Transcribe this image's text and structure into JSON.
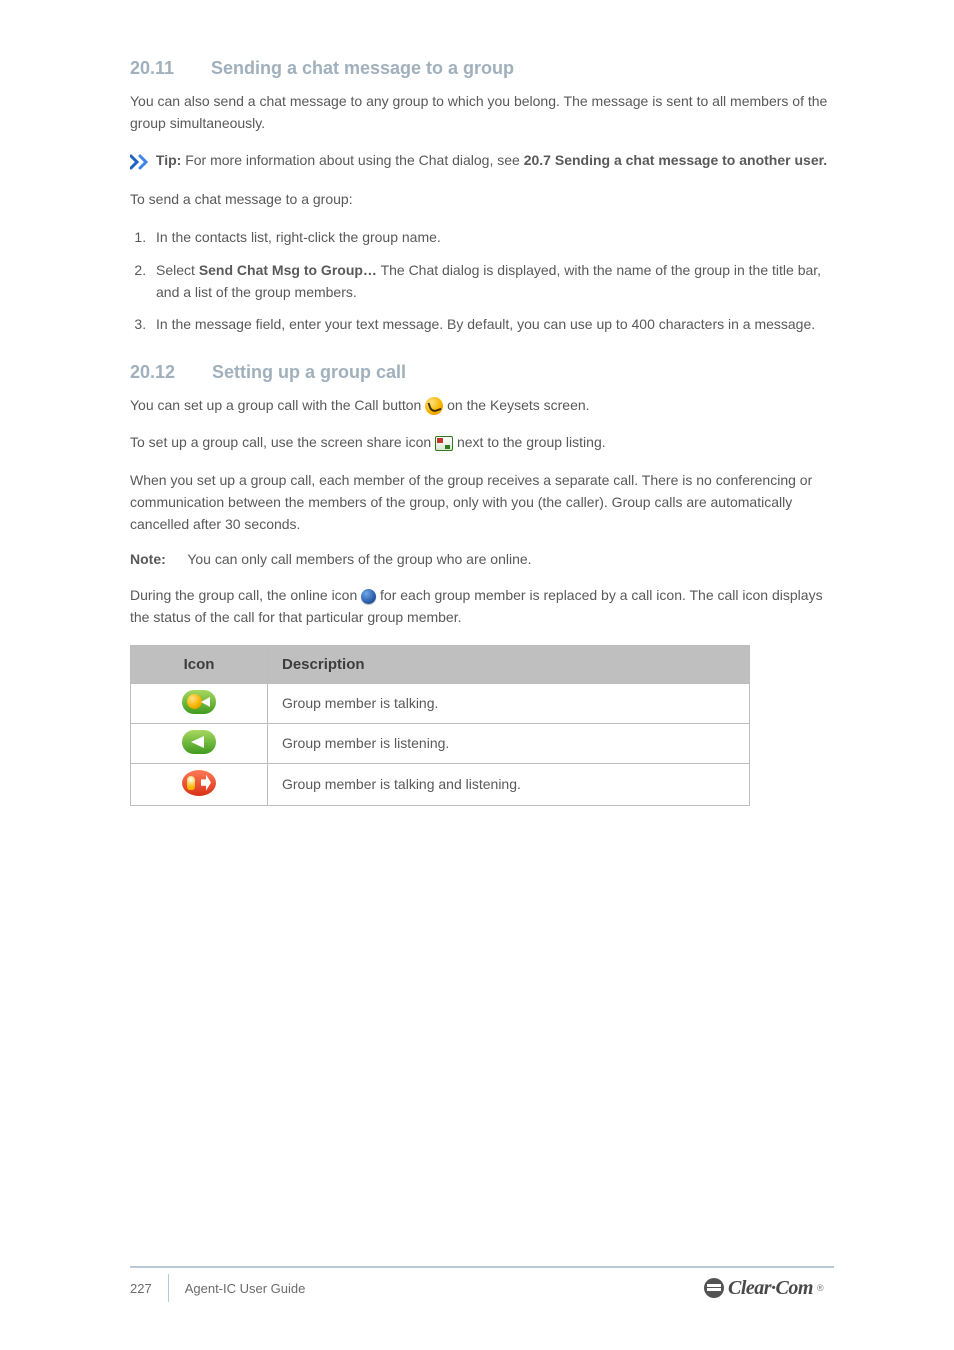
{
  "sections": {
    "chat_group": {
      "number": "20.11",
      "title": "Sending a chat message to a group",
      "intro_a": "You can also send a chat message to any group to which you belong. The message",
      "intro_b": "is sent to all members of the group simultaneously.",
      "tip_prefix": "Tip:",
      "tip_text": "For more information about using the Chat dialog, see",
      "tip_link_a": "20.7 Sending a chat",
      "tip_link_b": "message to another user.",
      "lead": "To send a chat message to a group:",
      "steps": [
        {
          "text": "In the contacts list, right-click the group name."
        },
        {
          "pre": "Select",
          "bold": "Send Chat Msg to Group…",
          "post": "The Chat dialog is displayed, with the name of the group in the title bar, and a list of the group members."
        },
        {
          "text": "In the message field, enter your text message. By default, you can use up to 400 characters in a message."
        }
      ]
    },
    "group_call": {
      "number": "20.12",
      "title": "Setting up a group call",
      "p1a": "You can set up a group call with the Call button",
      "p1b": "on the Keysets screen.",
      "p2a": "To set up a group call, use the screen share icon",
      "p2b": "next to the group listing.",
      "p3": "When you set up a group call, each member of the group receives a separate call. There is no conferencing or communication between the members of the group, only with you (the caller). Group calls are automatically cancelled after 30 seconds.",
      "note_label": "Note:",
      "note_text": "You can only call members of the group who are online.",
      "p4a": "During the group call, the online icon",
      "p4b": "for each group member is replaced by a call icon. The call icon displays the status of the call for that particular group member."
    },
    "icon_table": {
      "header_icon": "Icon",
      "header_desc": "Description",
      "rows": [
        {
          "icon": "tx",
          "desc": "Group member is talking."
        },
        {
          "icon": "lt",
          "desc": "Group member is listening."
        },
        {
          "icon": "dual",
          "desc": "Group member is talking and listening."
        }
      ]
    },
    "footer": {
      "page": "227",
      "doc": "Agent-IC User Guide",
      "logo": "Clear·Com",
      "reg": "®"
    }
  }
}
